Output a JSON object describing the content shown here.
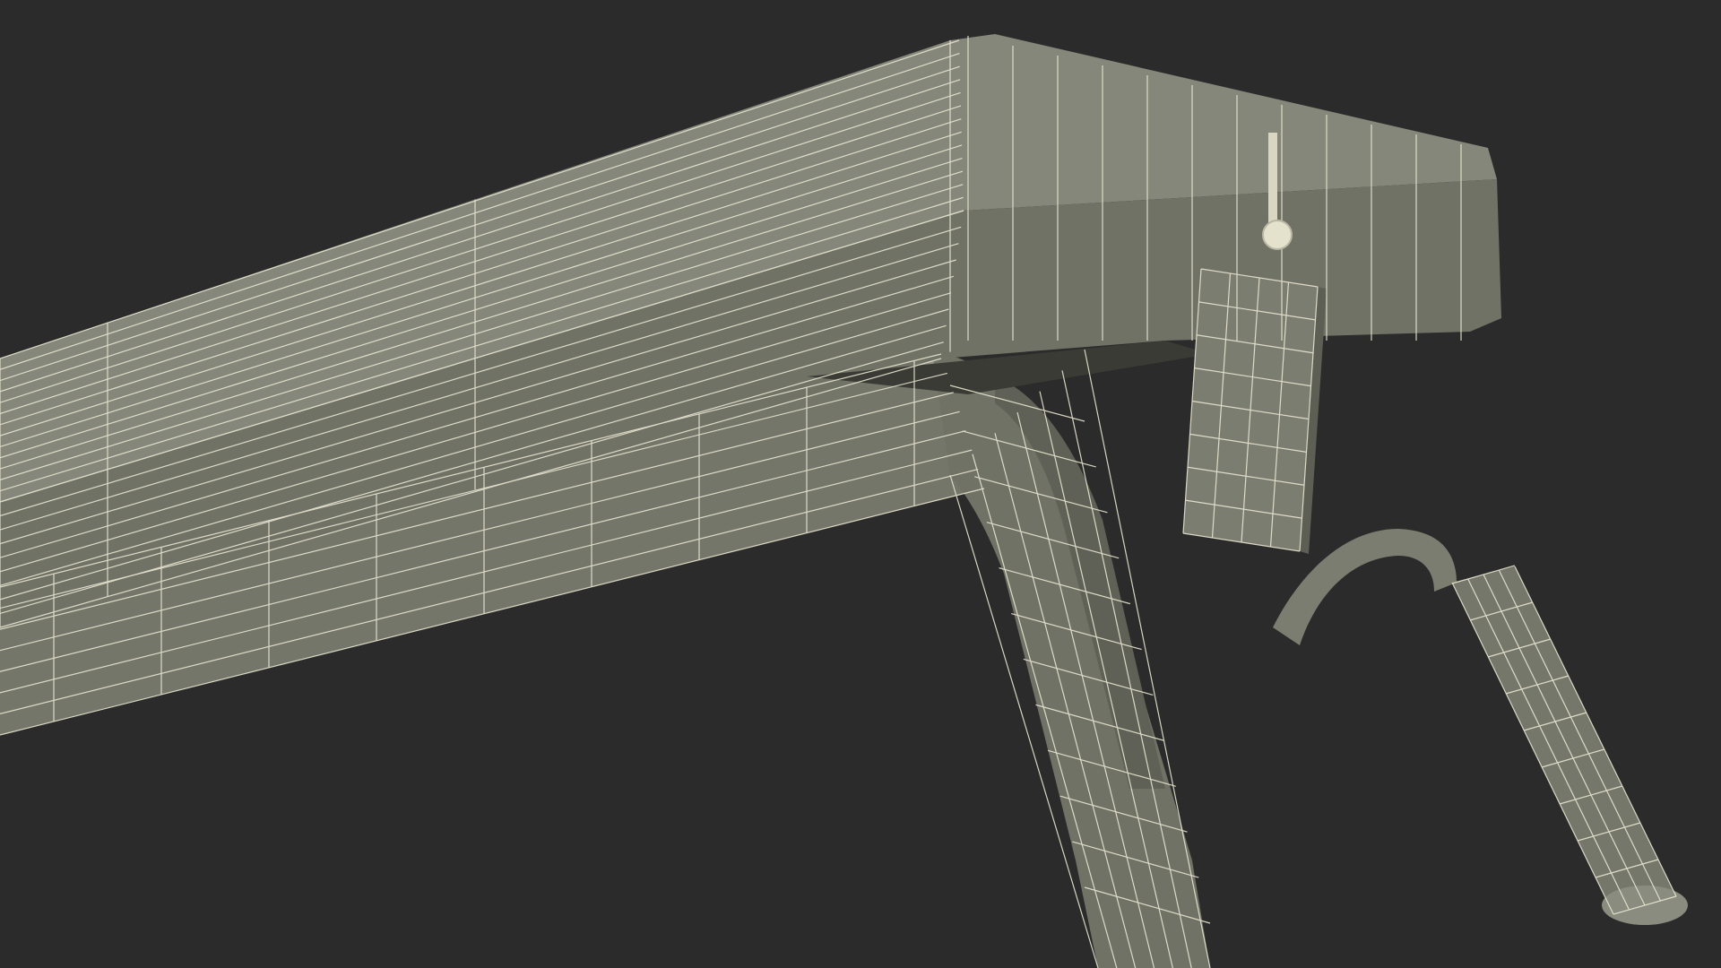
{
  "scene": {
    "background_color": "#2b2b2b",
    "surface_color": "#76786b",
    "surface_light": "#8b8d80",
    "surface_dark": "#5d5f54",
    "wire_color": "#e9e6d2",
    "shadow_color": "#1f201c"
  }
}
